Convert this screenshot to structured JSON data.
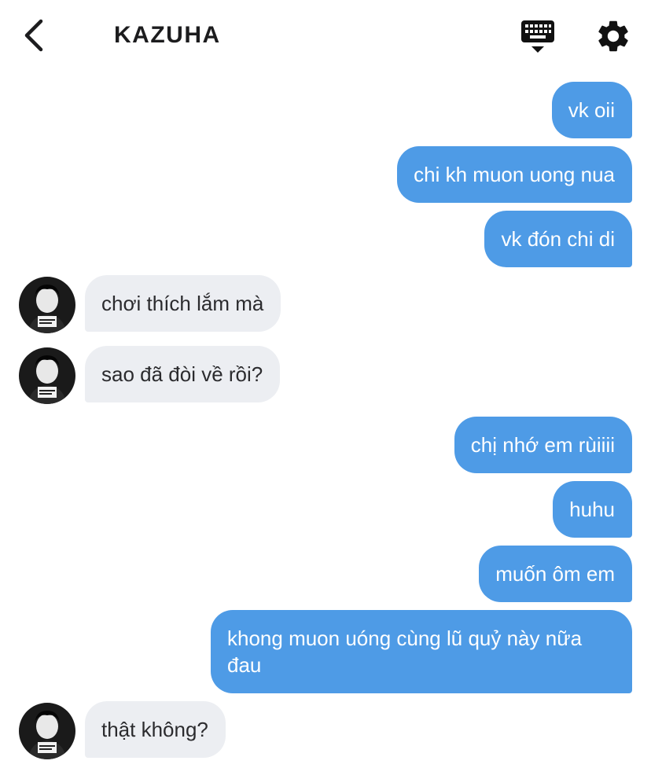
{
  "header": {
    "title": "KAZUHA",
    "back_icon": "chevron-left-icon",
    "keyboard_icon": "keyboard-icon",
    "settings_icon": "gear-icon"
  },
  "colors": {
    "outgoing_bubble": "#4e9be6",
    "incoming_bubble": "#eceef2",
    "header_text": "#1c1c1e"
  },
  "messages": [
    {
      "from": "me",
      "text": "vk oii"
    },
    {
      "from": "me",
      "text": "chi kh muon uong nua"
    },
    {
      "from": "me",
      "text": "vk đón chi di"
    },
    {
      "from": "them",
      "text": "chơi thích lắm mà"
    },
    {
      "from": "them",
      "text": "sao đã đòi về rồi?"
    },
    {
      "from": "me",
      "text": "chị nhớ em rùiiii"
    },
    {
      "from": "me",
      "text": "huhu"
    },
    {
      "from": "me",
      "text": "muốn ôm em"
    },
    {
      "from": "me",
      "text": "khong muon uóng cùng lũ quỷ này nữa đau"
    },
    {
      "from": "them",
      "text": "thật không?"
    }
  ]
}
